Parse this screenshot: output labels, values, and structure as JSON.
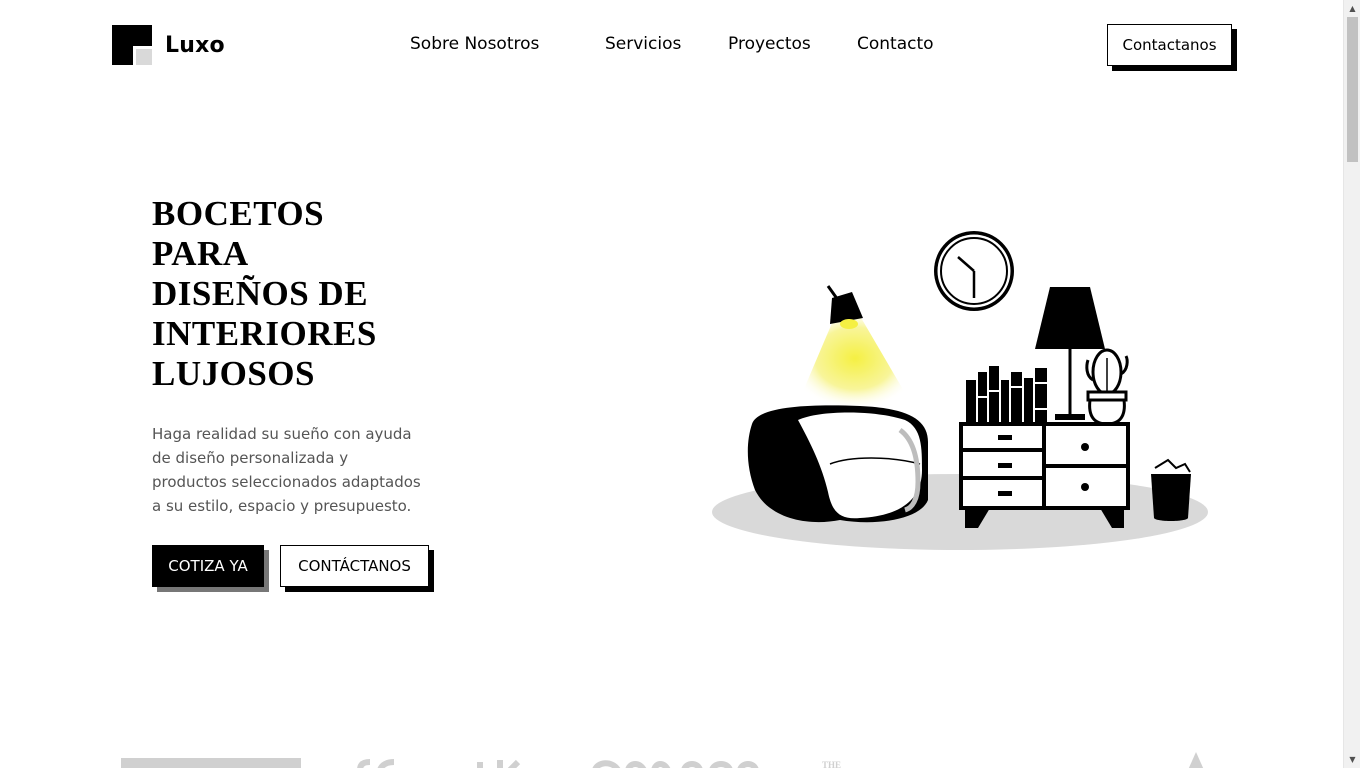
{
  "brand": {
    "name": "Luxo",
    "logo_icon": "logo-squares-icon"
  },
  "nav": {
    "items": [
      {
        "label": "Sobre Nosotros"
      },
      {
        "label": "Servicios"
      },
      {
        "label": "Proyectos"
      },
      {
        "label": "Contacto"
      }
    ],
    "cta_label": "Contactanos"
  },
  "hero": {
    "title_lines": [
      "BOCETOS",
      "PARA",
      "DISEÑOS DE",
      "INTERIORES",
      "LUJOSOS"
    ],
    "description": "Haga realidad su sueño con ayuda de diseño personalizada y productos seleccionados adaptados a su estilo, espacio y presupuesto.",
    "primary_button": "COTIZA YA",
    "secondary_button": "CONTÁCTANOS",
    "illustration_icon": "interior-living-room-illustration"
  },
  "colors": {
    "primary": "#000000",
    "background": "#ffffff",
    "accent_light": "#f5f043",
    "floor_gray": "#d9d9d9",
    "text_muted": "#555555"
  }
}
